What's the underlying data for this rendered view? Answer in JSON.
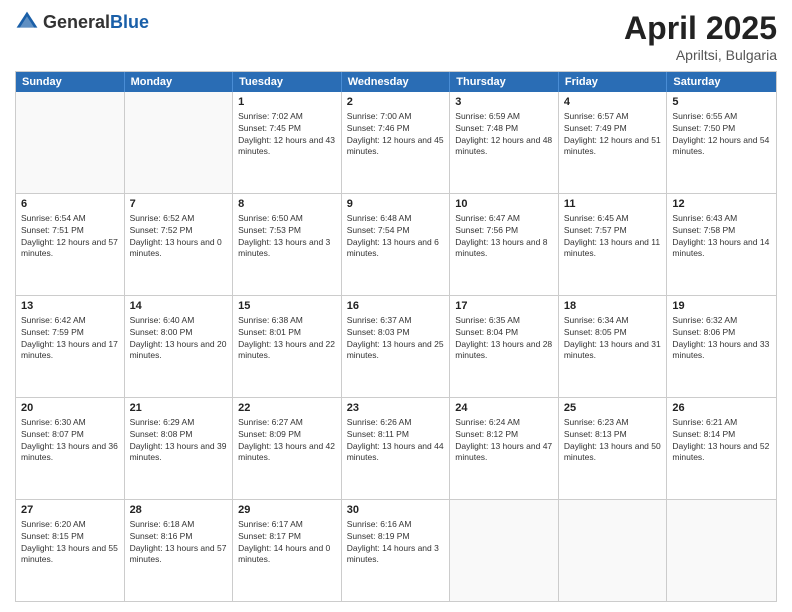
{
  "header": {
    "logo": {
      "general": "General",
      "blue": "Blue"
    },
    "title": "April 2025",
    "location": "Apriltsi, Bulgaria"
  },
  "weekdays": [
    "Sunday",
    "Monday",
    "Tuesday",
    "Wednesday",
    "Thursday",
    "Friday",
    "Saturday"
  ],
  "weeks": [
    [
      {
        "day": "",
        "text": ""
      },
      {
        "day": "",
        "text": ""
      },
      {
        "day": "1",
        "text": "Sunrise: 7:02 AM\nSunset: 7:45 PM\nDaylight: 12 hours and 43 minutes."
      },
      {
        "day": "2",
        "text": "Sunrise: 7:00 AM\nSunset: 7:46 PM\nDaylight: 12 hours and 45 minutes."
      },
      {
        "day": "3",
        "text": "Sunrise: 6:59 AM\nSunset: 7:48 PM\nDaylight: 12 hours and 48 minutes."
      },
      {
        "day": "4",
        "text": "Sunrise: 6:57 AM\nSunset: 7:49 PM\nDaylight: 12 hours and 51 minutes."
      },
      {
        "day": "5",
        "text": "Sunrise: 6:55 AM\nSunset: 7:50 PM\nDaylight: 12 hours and 54 minutes."
      }
    ],
    [
      {
        "day": "6",
        "text": "Sunrise: 6:54 AM\nSunset: 7:51 PM\nDaylight: 12 hours and 57 minutes."
      },
      {
        "day": "7",
        "text": "Sunrise: 6:52 AM\nSunset: 7:52 PM\nDaylight: 13 hours and 0 minutes."
      },
      {
        "day": "8",
        "text": "Sunrise: 6:50 AM\nSunset: 7:53 PM\nDaylight: 13 hours and 3 minutes."
      },
      {
        "day": "9",
        "text": "Sunrise: 6:48 AM\nSunset: 7:54 PM\nDaylight: 13 hours and 6 minutes."
      },
      {
        "day": "10",
        "text": "Sunrise: 6:47 AM\nSunset: 7:56 PM\nDaylight: 13 hours and 8 minutes."
      },
      {
        "day": "11",
        "text": "Sunrise: 6:45 AM\nSunset: 7:57 PM\nDaylight: 13 hours and 11 minutes."
      },
      {
        "day": "12",
        "text": "Sunrise: 6:43 AM\nSunset: 7:58 PM\nDaylight: 13 hours and 14 minutes."
      }
    ],
    [
      {
        "day": "13",
        "text": "Sunrise: 6:42 AM\nSunset: 7:59 PM\nDaylight: 13 hours and 17 minutes."
      },
      {
        "day": "14",
        "text": "Sunrise: 6:40 AM\nSunset: 8:00 PM\nDaylight: 13 hours and 20 minutes."
      },
      {
        "day": "15",
        "text": "Sunrise: 6:38 AM\nSunset: 8:01 PM\nDaylight: 13 hours and 22 minutes."
      },
      {
        "day": "16",
        "text": "Sunrise: 6:37 AM\nSunset: 8:03 PM\nDaylight: 13 hours and 25 minutes."
      },
      {
        "day": "17",
        "text": "Sunrise: 6:35 AM\nSunset: 8:04 PM\nDaylight: 13 hours and 28 minutes."
      },
      {
        "day": "18",
        "text": "Sunrise: 6:34 AM\nSunset: 8:05 PM\nDaylight: 13 hours and 31 minutes."
      },
      {
        "day": "19",
        "text": "Sunrise: 6:32 AM\nSunset: 8:06 PM\nDaylight: 13 hours and 33 minutes."
      }
    ],
    [
      {
        "day": "20",
        "text": "Sunrise: 6:30 AM\nSunset: 8:07 PM\nDaylight: 13 hours and 36 minutes."
      },
      {
        "day": "21",
        "text": "Sunrise: 6:29 AM\nSunset: 8:08 PM\nDaylight: 13 hours and 39 minutes."
      },
      {
        "day": "22",
        "text": "Sunrise: 6:27 AM\nSunset: 8:09 PM\nDaylight: 13 hours and 42 minutes."
      },
      {
        "day": "23",
        "text": "Sunrise: 6:26 AM\nSunset: 8:11 PM\nDaylight: 13 hours and 44 minutes."
      },
      {
        "day": "24",
        "text": "Sunrise: 6:24 AM\nSunset: 8:12 PM\nDaylight: 13 hours and 47 minutes."
      },
      {
        "day": "25",
        "text": "Sunrise: 6:23 AM\nSunset: 8:13 PM\nDaylight: 13 hours and 50 minutes."
      },
      {
        "day": "26",
        "text": "Sunrise: 6:21 AM\nSunset: 8:14 PM\nDaylight: 13 hours and 52 minutes."
      }
    ],
    [
      {
        "day": "27",
        "text": "Sunrise: 6:20 AM\nSunset: 8:15 PM\nDaylight: 13 hours and 55 minutes."
      },
      {
        "day": "28",
        "text": "Sunrise: 6:18 AM\nSunset: 8:16 PM\nDaylight: 13 hours and 57 minutes."
      },
      {
        "day": "29",
        "text": "Sunrise: 6:17 AM\nSunset: 8:17 PM\nDaylight: 14 hours and 0 minutes."
      },
      {
        "day": "30",
        "text": "Sunrise: 6:16 AM\nSunset: 8:19 PM\nDaylight: 14 hours and 3 minutes."
      },
      {
        "day": "",
        "text": ""
      },
      {
        "day": "",
        "text": ""
      },
      {
        "day": "",
        "text": ""
      }
    ]
  ]
}
